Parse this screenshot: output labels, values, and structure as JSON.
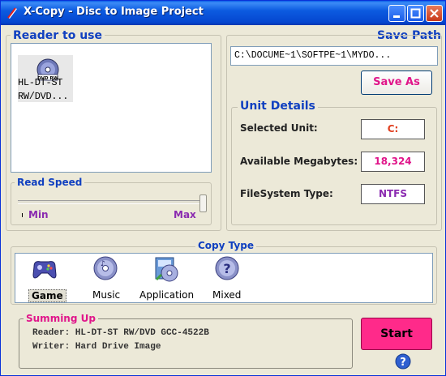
{
  "window": {
    "title": "X-Copy - Disc to Image Project"
  },
  "reader": {
    "group_label": "Reader to use",
    "drive_icon": "dvd-rw-drive-icon",
    "drive_icon_text": "DVD RW",
    "drive_name_line1": "HL-DT-ST",
    "drive_name_line2": "RW/DVD..."
  },
  "read_speed": {
    "group_label": "Read Speed",
    "min_label": "Min",
    "max_label": "Max",
    "value": 1.0
  },
  "save_path": {
    "label": "Save Path",
    "value": "C:\\DOCUME~1\\SOFTPE~1\\MYDO...",
    "save_as_label": "Save As"
  },
  "unit_details": {
    "group_label": "Unit Details",
    "selected_unit_label": "Selected Unit:",
    "selected_unit_value": "C:",
    "available_mb_label": "Available Megabytes:",
    "available_mb_value": "18,324",
    "filesystem_label": "FileSystem Type:",
    "filesystem_value": "NTFS"
  },
  "copy_type": {
    "group_label": "Copy Type",
    "options": [
      {
        "label": "Game",
        "icon": "gamepad-icon",
        "selected": true
      },
      {
        "label": "Music",
        "icon": "music-disc-icon",
        "selected": false
      },
      {
        "label": "Application",
        "icon": "application-disc-icon",
        "selected": false
      },
      {
        "label": "Mixed",
        "icon": "mixed-disc-icon",
        "selected": false
      }
    ]
  },
  "summing_up": {
    "group_label": "Summing Up",
    "reader_line": "Reader: HL-DT-ST RW/DVD GCC-4522B",
    "writer_line": "Writer: Hard Drive Image"
  },
  "actions": {
    "start_label": "Start",
    "help_icon": "help-icon"
  },
  "colors": {
    "title_bar": "#0a5fe8",
    "group_label": "#1040c0",
    "accent_pink": "#e0158a",
    "start_button": "#ff2a8a",
    "unit_value": "#e04020",
    "megabytes_value": "#e0158a",
    "filesystem_value": "#8a2ab0"
  }
}
